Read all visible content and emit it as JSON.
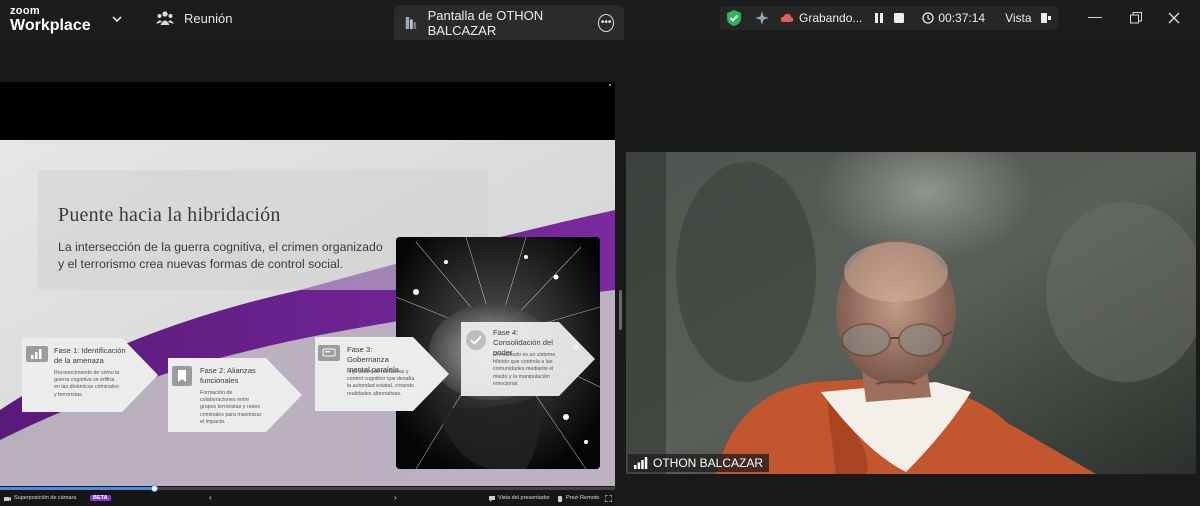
{
  "app": {
    "brand_line1": "zoom",
    "brand_line2": "Workplace"
  },
  "meeting": {
    "label": "Reunión",
    "icon": "people-icon"
  },
  "share_tab": {
    "label": "Pantalla de OTHON BALCAZAR",
    "icon": "screen-share-icon",
    "more_icon": "more-options-icon"
  },
  "recording": {
    "status": "Grabando...",
    "timer": "00:37:14",
    "view_label": "Vista",
    "shield_color": "#2fb35c",
    "rec_color": "#e25a5a"
  },
  "slide": {
    "title": "Puente hacia la hibridación",
    "subtitle": "La intersección de la guerra cognitiva, el crimen organizado y el terrorismo crea nuevas formas de control social.",
    "accent_color": "#6a1e8f",
    "phases": [
      {
        "title": "Fase 1: Identificación de la amenaza",
        "desc": "Reconocimiento de cómo la guerra cognitiva se infiltra en las dinámicas criminales y terroristas.",
        "icon": "bar-chart-icon"
      },
      {
        "title": "Fase 2: Alianzas funcionales",
        "desc": "Formación de colaboraciones entre grupos terroristas y redes criminales para maximizar el impacto.",
        "icon": "bookmark-icon"
      },
      {
        "title": "Fase 3: Gobernanza mental paralela",
        "desc": "Imposición de narrativas y control cognitivo que desafía la autoridad estatal, creando realidades alternativas.",
        "icon": "message-icon"
      },
      {
        "title": "Fase 4: Consolidación del poder",
        "desc": "El resultado es un sistema híbrido que controla a las comunidades mediante el miedo y la manipulación emocional.",
        "icon": "check-icon"
      }
    ]
  },
  "player": {
    "overlay_label": "Superposición de cámara",
    "beta": "BETA",
    "presenter_view": "Vista del presentador",
    "prezi_remote": "Prezi Remote",
    "progress": 0.25
  },
  "participant": {
    "name": "OTHON BALCAZAR"
  }
}
